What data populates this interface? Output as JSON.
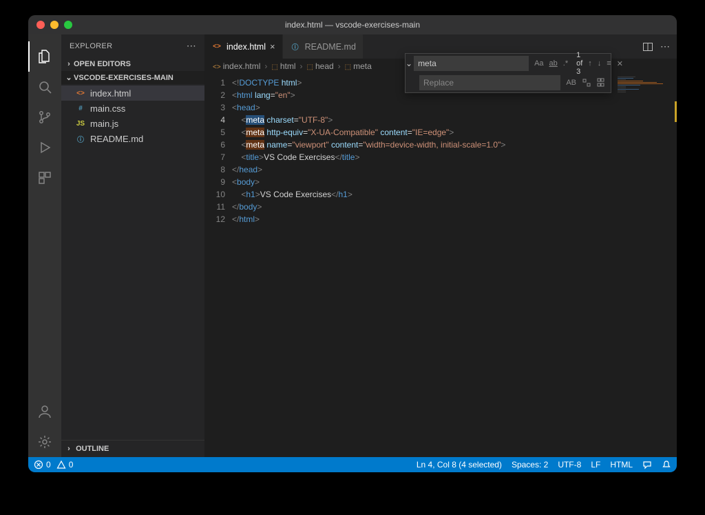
{
  "title": "index.html — vscode-exercises-main",
  "sidebar": {
    "header": "EXPLORER",
    "open_editors": "OPEN EDITORS",
    "folder": "VSCODE-EXERCISES-MAIN",
    "files": [
      {
        "name": "index.html",
        "type": "html",
        "active": true
      },
      {
        "name": "main.css",
        "type": "css"
      },
      {
        "name": "main.js",
        "type": "js"
      },
      {
        "name": "README.md",
        "type": "md"
      }
    ],
    "outline": "OUTLINE"
  },
  "tabs": [
    {
      "label": "index.html",
      "type": "html",
      "active": true,
      "dirty": false
    },
    {
      "label": "README.md",
      "type": "md",
      "active": false
    }
  ],
  "breadcrumb": [
    "index.html",
    "html",
    "head",
    "meta"
  ],
  "find": {
    "search_value": "meta",
    "replace_placeholder": "Replace",
    "result": "1 of 3",
    "icons": {
      "case": "Aa",
      "word": "ab",
      "regex": ".*",
      "preserve": "AB"
    }
  },
  "code": {
    "lines": [
      {
        "n": 1,
        "html": "<span class='t-ang'>&lt;!</span><span class='t-doc'>DOCTYPE</span> <span class='t-attr'>html</span><span class='t-ang'>&gt;</span>"
      },
      {
        "n": 2,
        "html": "<span class='t-ang'>&lt;</span><span class='t-tag'>html</span> <span class='t-attr'>lang</span>=<span class='t-str'>\"en\"</span><span class='t-ang'>&gt;</span>"
      },
      {
        "n": 3,
        "html": "<span class='t-ang'>&lt;</span><span class='t-tag'>head</span><span class='t-ang'>&gt;</span>"
      },
      {
        "n": 4,
        "cur": true,
        "html": "    <span class='t-ang'>&lt;</span><span class='sel hl'>meta</span> <span class='t-attr'>charset</span>=<span class='t-str'>\"UTF-8\"</span><span class='t-ang'>&gt;</span>"
      },
      {
        "n": 5,
        "html": "    <span class='t-ang'>&lt;</span><span class='hl'>meta</span> <span class='t-attr'>http-equiv</span>=<span class='t-str'>\"X-UA-Compatible\"</span> <span class='t-attr'>content</span>=<span class='t-str'>\"IE=edge\"</span><span class='t-ang'>&gt;</span>"
      },
      {
        "n": 6,
        "html": "    <span class='t-ang'>&lt;</span><span class='hl'>meta</span> <span class='t-attr'>name</span>=<span class='t-str'>\"viewport\"</span> <span class='t-attr'>content</span>=<span class='t-str'>\"width=device-width, initial-scale=1.0\"</span><span class='t-ang'>&gt;</span>"
      },
      {
        "n": 7,
        "html": "    <span class='t-ang'>&lt;</span><span class='t-tag'>title</span><span class='t-ang'>&gt;</span><span class='t-txt'>VS Code Exercises</span><span class='t-ang'>&lt;/</span><span class='t-tag'>title</span><span class='t-ang'>&gt;</span>"
      },
      {
        "n": 8,
        "html": "<span class='t-ang'>&lt;/</span><span class='t-tag'>head</span><span class='t-ang'>&gt;</span>"
      },
      {
        "n": 9,
        "html": "<span class='t-ang'>&lt;</span><span class='t-tag'>body</span><span class='t-ang'>&gt;</span>"
      },
      {
        "n": 10,
        "html": "    <span class='t-ang'>&lt;</span><span class='t-tag'>h1</span><span class='t-ang'>&gt;</span><span class='t-txt'>VS Code Exercises</span><span class='t-ang'>&lt;/</span><span class='t-tag'>h1</span><span class='t-ang'>&gt;</span>"
      },
      {
        "n": 11,
        "html": "<span class='t-ang'>&lt;/</span><span class='t-tag'>body</span><span class='t-ang'>&gt;</span>"
      },
      {
        "n": 12,
        "html": "<span class='t-ang'>&lt;/</span><span class='t-tag'>html</span><span class='t-ang'>&gt;</span>"
      }
    ]
  },
  "status": {
    "errors": "0",
    "warnings": "0",
    "cursor": "Ln 4, Col 8 (4 selected)",
    "spaces": "Spaces: 2",
    "encoding": "UTF-8",
    "eol": "LF",
    "lang": "HTML"
  }
}
